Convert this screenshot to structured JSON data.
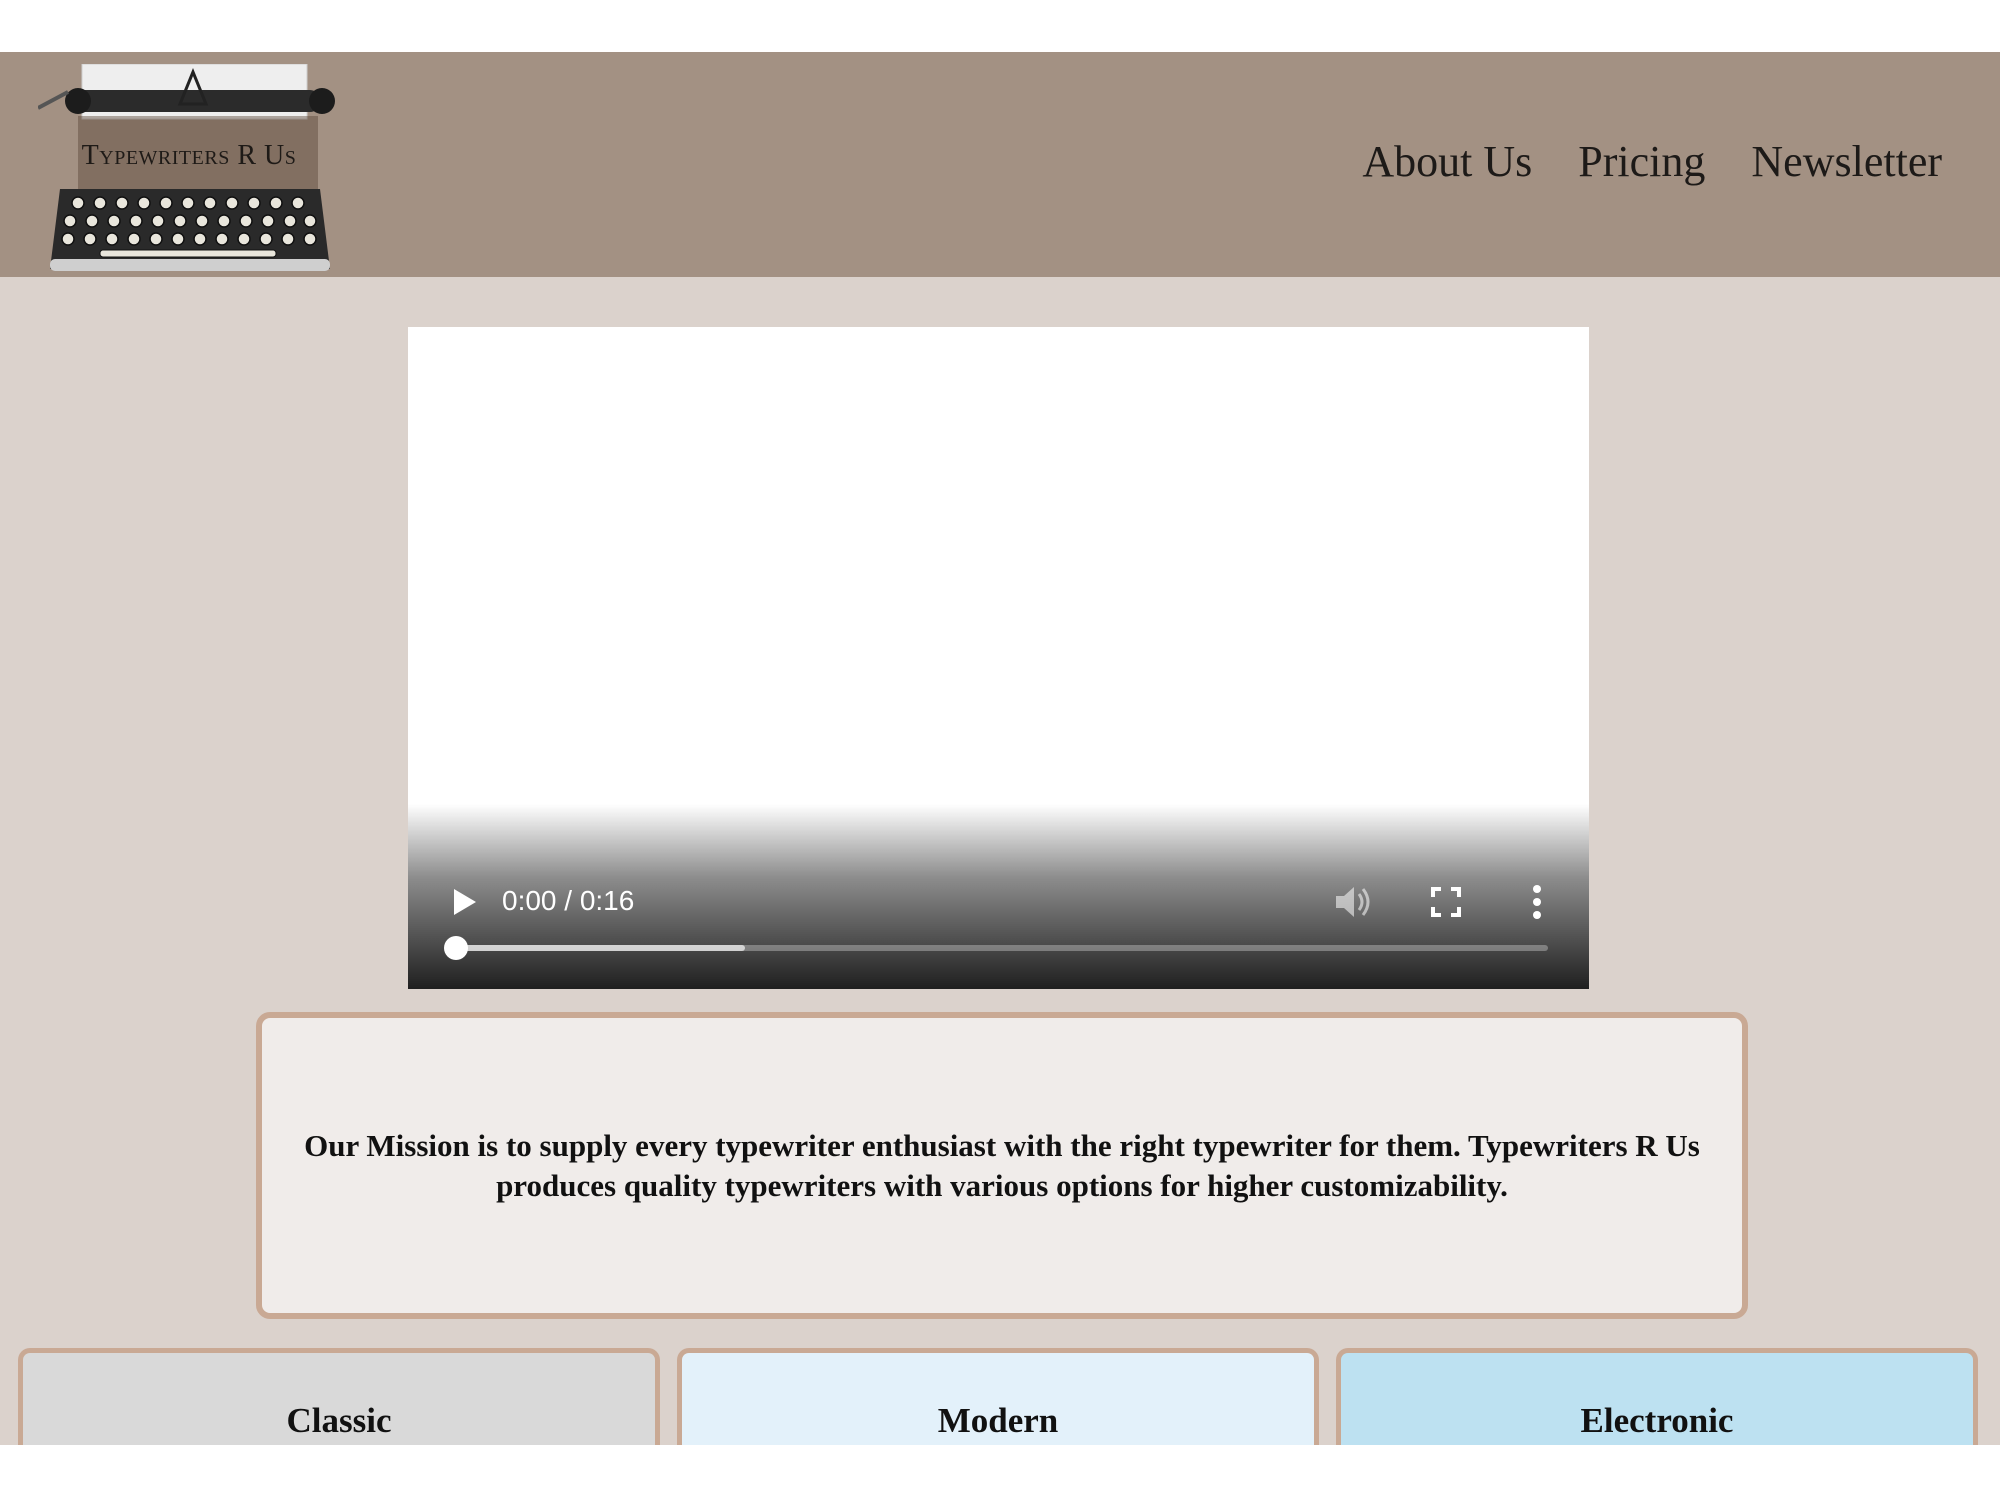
{
  "brand": {
    "logo_text": "Typewriters R Us",
    "icon": "typewriter-icon"
  },
  "nav": {
    "items": [
      {
        "label": "About Us"
      },
      {
        "label": "Pricing"
      },
      {
        "label": "Newsletter"
      }
    ]
  },
  "video": {
    "time": "0:00 / 0:16",
    "progress": 0,
    "buffered": 0.27,
    "icons": [
      "play-icon",
      "volume-icon",
      "fullscreen-icon",
      "more-vert-icon"
    ]
  },
  "mission": {
    "text": "Our Mission is to supply every typewriter enthusiast with the right typewriter for them. Typewriters R Us produces quality typewriters with various options for higher customizability."
  },
  "categories": [
    {
      "label": "Classic"
    },
    {
      "label": "Modern"
    },
    {
      "label": "Electronic"
    }
  ],
  "colors": {
    "header": "#a39183",
    "page": "#dbd2cc",
    "accent_border": "#c9a994",
    "mission_bg": "#f0ecea",
    "classic": "#d9d9d9",
    "modern": "#e3f1fa",
    "electronic": "#bde1f1"
  }
}
